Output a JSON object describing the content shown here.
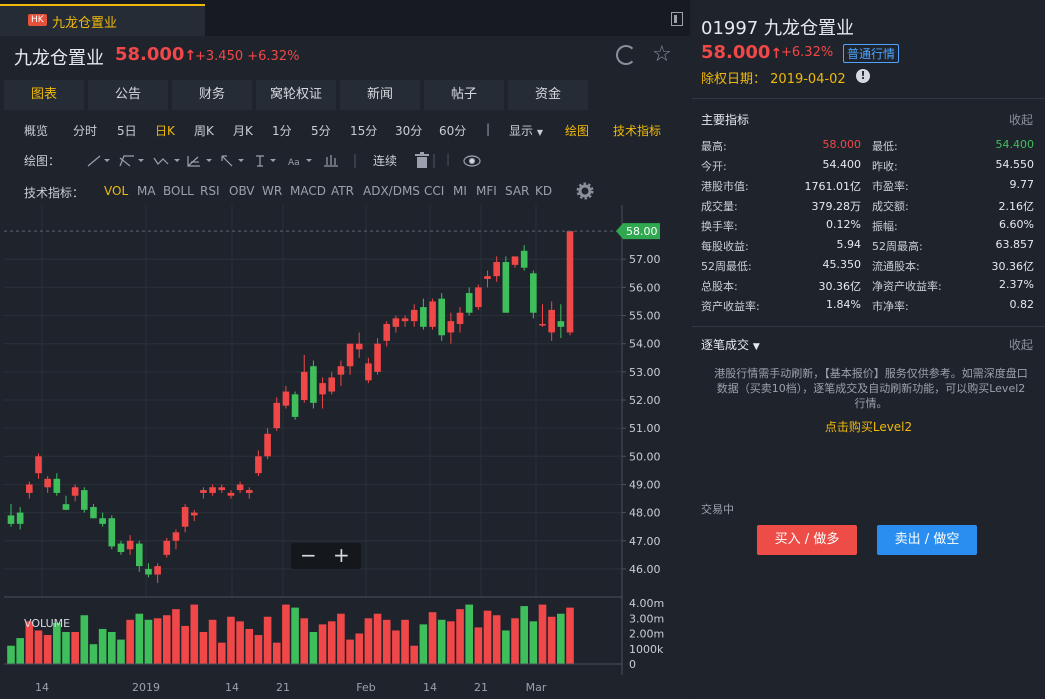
{
  "tab": {
    "market_badge": "HK",
    "title": "九龙仓置业"
  },
  "header": {
    "name": "九龙仓置业",
    "price": "58.000",
    "change": "+3.450",
    "change_pct": "+6.32%"
  },
  "nav_tabs": [
    "图表",
    "公告",
    "财务",
    "窝轮权证",
    "新闻",
    "帖子",
    "资金"
  ],
  "periods": [
    "概览",
    "分时",
    "5日",
    "日K",
    "周K",
    "月K",
    "1分",
    "5分",
    "15分",
    "30分",
    "60分"
  ],
  "period_active": "日K",
  "display_menu": "显示",
  "draw_link": "绘图",
  "tech_link": "技术指标",
  "draw_label": "绘图：",
  "continuous": "连续",
  "indicator_label": "技术指标：",
  "indicators": [
    "VOL",
    "MA",
    "BOLL",
    "RSI",
    "OBV",
    "WR",
    "MACD",
    "ATR",
    "ADX/DMS",
    "CCI",
    "MI",
    "MFI",
    "SAR",
    "KD"
  ],
  "indicator_active": "VOL",
  "chart_data": {
    "type": "candlestick",
    "last_price_label": "58.00",
    "y_ticks": [
      "57.00",
      "56.00",
      "55.00",
      "54.00",
      "53.00",
      "52.00",
      "51.00",
      "50.00",
      "49.00",
      "48.00",
      "47.00",
      "46.00"
    ],
    "ylim": [
      45.5,
      58.5
    ],
    "x_ticks": [
      "14",
      "2019",
      "14",
      "21",
      "Feb",
      "14",
      "21",
      "Mar"
    ],
    "volume_label": "VOLUME",
    "volume_ticks": [
      "4.00m",
      "3.00m",
      "2.00m",
      "1000k",
      "0"
    ],
    "volume_ylim": [
      0,
      4.2
    ],
    "up_color": "#f04848",
    "down_color": "#3fbf5c",
    "candles": [
      {
        "o": 47.9,
        "h": 48.3,
        "l": 47.5,
        "c": 47.6
      },
      {
        "o": 48.0,
        "h": 48.2,
        "l": 47.4,
        "c": 47.6
      },
      {
        "o": 48.7,
        "h": 49.1,
        "l": 48.5,
        "c": 49.0
      },
      {
        "o": 49.4,
        "h": 50.1,
        "l": 49.2,
        "c": 50.0
      },
      {
        "o": 48.9,
        "h": 49.3,
        "l": 48.7,
        "c": 49.2
      },
      {
        "o": 49.2,
        "h": 49.4,
        "l": 48.6,
        "c": 48.7
      },
      {
        "o": 48.3,
        "h": 48.6,
        "l": 48.1,
        "c": 48.1
      },
      {
        "o": 48.6,
        "h": 49.0,
        "l": 48.4,
        "c": 48.9
      },
      {
        "o": 48.8,
        "h": 48.9,
        "l": 48.0,
        "c": 48.1
      },
      {
        "o": 48.2,
        "h": 48.3,
        "l": 47.8,
        "c": 47.8
      },
      {
        "o": 47.8,
        "h": 48.0,
        "l": 47.5,
        "c": 47.6
      },
      {
        "o": 47.8,
        "h": 47.9,
        "l": 46.7,
        "c": 46.8
      },
      {
        "o": 46.9,
        "h": 47.0,
        "l": 46.5,
        "c": 46.6
      },
      {
        "o": 46.7,
        "h": 47.2,
        "l": 46.5,
        "c": 47.0
      },
      {
        "o": 46.9,
        "h": 47.0,
        "l": 45.9,
        "c": 46.1
      },
      {
        "o": 46.0,
        "h": 46.2,
        "l": 45.7,
        "c": 45.8
      },
      {
        "o": 45.8,
        "h": 46.2,
        "l": 45.5,
        "c": 46.1
      },
      {
        "o": 46.5,
        "h": 47.1,
        "l": 46.4,
        "c": 47.0
      },
      {
        "o": 47.0,
        "h": 47.4,
        "l": 46.7,
        "c": 47.3
      },
      {
        "o": 47.5,
        "h": 48.3,
        "l": 47.3,
        "c": 48.2
      },
      {
        "o": 47.9,
        "h": 48.1,
        "l": 47.7,
        "c": 48.0
      },
      {
        "o": 48.7,
        "h": 48.9,
        "l": 48.5,
        "c": 48.8
      },
      {
        "o": 48.7,
        "h": 49.0,
        "l": 48.6,
        "c": 48.9
      },
      {
        "o": 48.8,
        "h": 49.0,
        "l": 48.7,
        "c": 48.9
      },
      {
        "o": 48.6,
        "h": 48.8,
        "l": 48.5,
        "c": 48.7
      },
      {
        "o": 48.8,
        "h": 49.1,
        "l": 48.7,
        "c": 49.0
      },
      {
        "o": 48.7,
        "h": 48.9,
        "l": 48.5,
        "c": 48.8
      },
      {
        "o": 49.4,
        "h": 50.2,
        "l": 49.3,
        "c": 50.0
      },
      {
        "o": 50.0,
        "h": 51.0,
        "l": 49.9,
        "c": 50.8
      },
      {
        "o": 51.0,
        "h": 52.1,
        "l": 50.9,
        "c": 51.9
      },
      {
        "o": 51.8,
        "h": 52.5,
        "l": 51.7,
        "c": 52.3
      },
      {
        "o": 52.2,
        "h": 52.3,
        "l": 51.3,
        "c": 51.4
      },
      {
        "o": 52.0,
        "h": 53.6,
        "l": 51.9,
        "c": 53.0
      },
      {
        "o": 53.2,
        "h": 53.4,
        "l": 51.7,
        "c": 51.9
      },
      {
        "o": 52.2,
        "h": 52.8,
        "l": 51.7,
        "c": 52.6
      },
      {
        "o": 52.3,
        "h": 53.0,
        "l": 52.2,
        "c": 52.8
      },
      {
        "o": 52.9,
        "h": 53.4,
        "l": 52.5,
        "c": 53.2
      },
      {
        "o": 53.2,
        "h": 53.9,
        "l": 52.9,
        "c": 54.0
      },
      {
        "o": 53.8,
        "h": 54.4,
        "l": 53.5,
        "c": 54.0
      },
      {
        "o": 52.7,
        "h": 53.5,
        "l": 52.6,
        "c": 53.3
      },
      {
        "o": 53.0,
        "h": 54.2,
        "l": 52.9,
        "c": 54.0
      },
      {
        "o": 54.1,
        "h": 54.8,
        "l": 53.9,
        "c": 54.7
      },
      {
        "o": 54.6,
        "h": 55.0,
        "l": 54.4,
        "c": 54.9
      },
      {
        "o": 54.8,
        "h": 55.0,
        "l": 54.6,
        "c": 54.9
      },
      {
        "o": 54.8,
        "h": 55.4,
        "l": 54.6,
        "c": 55.2
      },
      {
        "o": 55.3,
        "h": 55.6,
        "l": 54.5,
        "c": 54.6
      },
      {
        "o": 54.6,
        "h": 55.6,
        "l": 54.5,
        "c": 55.5
      },
      {
        "o": 55.6,
        "h": 55.8,
        "l": 54.1,
        "c": 54.3
      },
      {
        "o": 54.4,
        "h": 55.1,
        "l": 54.0,
        "c": 54.8
      },
      {
        "o": 54.7,
        "h": 55.3,
        "l": 54.4,
        "c": 55.1
      },
      {
        "o": 55.8,
        "h": 56.0,
        "l": 55.0,
        "c": 55.1
      },
      {
        "o": 55.3,
        "h": 56.1,
        "l": 55.2,
        "c": 56.0
      },
      {
        "o": 56.3,
        "h": 56.6,
        "l": 56.0,
        "c": 56.4
      },
      {
        "o": 56.4,
        "h": 57.1,
        "l": 56.2,
        "c": 56.9
      },
      {
        "o": 56.9,
        "h": 57.1,
        "l": 55.1,
        "c": 55.1
      },
      {
        "o": 56.8,
        "h": 57.1,
        "l": 56.7,
        "c": 57.1
      },
      {
        "o": 57.3,
        "h": 57.5,
        "l": 56.6,
        "c": 56.7
      },
      {
        "o": 56.5,
        "h": 56.6,
        "l": 54.9,
        "c": 55.1
      },
      {
        "o": 54.7,
        "h": 55.4,
        "l": 54.6,
        "c": 54.7
      },
      {
        "o": 54.4,
        "h": 55.5,
        "l": 54.1,
        "c": 55.2
      },
      {
        "o": 54.8,
        "h": 55.4,
        "l": 54.2,
        "c": 54.6
      },
      {
        "o": 54.4,
        "h": 58.0,
        "l": 54.3,
        "c": 58.0
      }
    ],
    "volumes": [
      1.2,
      1.7,
      2.8,
      2.2,
      1.9,
      2.7,
      2.1,
      2.1,
      3.2,
      1.3,
      2.3,
      2.1,
      1.6,
      2.9,
      3.3,
      2.9,
      3.0,
      3.2,
      3.6,
      2.5,
      3.9,
      2.1,
      2.9,
      1.4,
      3.1,
      2.8,
      2.3,
      1.9,
      3.1,
      1.4,
      3.9,
      3.7,
      3.0,
      2.1,
      2.6,
      2.8,
      3.3,
      1.6,
      2.0,
      3.0,
      3.3,
      2.9,
      2.2,
      2.9,
      1.2,
      2.6,
      3.4,
      2.9,
      2.8,
      3.6,
      3.9,
      2.4,
      3.5,
      3.2,
      2.2,
      3.0,
      3.8,
      2.8,
      3.9,
      3.1,
      3.3,
      3.7
    ]
  },
  "right": {
    "title": "01997 九龙仓置业",
    "price": "58.000",
    "change_pct": "+6.32%",
    "quote_badge": "普通行情",
    "ex_date_label": "除权日期：",
    "ex_date": "2019-04-02",
    "info_icon": "!",
    "metrics_title": "主要指标",
    "collapse": "收起",
    "metrics": [
      {
        "k1": "最高:",
        "v1": "58.000",
        "c1": "#f04848",
        "k2": "最低:",
        "v2": "54.400",
        "c2": "#3fbf5c"
      },
      {
        "k1": "今开:",
        "v1": "54.400",
        "c1": "",
        "k2": "昨收:",
        "v2": "54.550",
        "c2": ""
      },
      {
        "k1": "港股市值:",
        "v1": "1761.01亿",
        "c1": "",
        "k2": "市盈率:",
        "v2": "9.77",
        "c2": ""
      },
      {
        "k1": "成交量:",
        "v1": "379.28万",
        "c1": "",
        "k2": "成交额:",
        "v2": "2.16亿",
        "c2": ""
      },
      {
        "k1": "换手率:",
        "v1": "0.12%",
        "c1": "",
        "k2": "振幅:",
        "v2": "6.60%",
        "c2": ""
      },
      {
        "k1": "每股收益:",
        "v1": "5.94",
        "c1": "",
        "k2": "52周最高:",
        "v2": "63.857",
        "c2": ""
      },
      {
        "k1": "52周最低:",
        "v1": "45.350",
        "c1": "",
        "k2": "流通股本:",
        "v2": "30.36亿",
        "c2": ""
      },
      {
        "k1": "总股本:",
        "v1": "30.36亿",
        "c1": "",
        "k2": "净资产收益率:",
        "v2": "2.37%",
        "c2": ""
      },
      {
        "k1": "资产收益率:",
        "v1": "1.84%",
        "c1": "",
        "k2": "市净率:",
        "v2": "0.82",
        "c2": ""
      }
    ],
    "tick_title": "逐笔成交",
    "tick_collapse": "收起",
    "tick_notice": "港股行情需手动刷新，【基本报价】服务仅供参考。如需深度盘口数据（买卖10档），逐笔成交及自动刷新功能，可以购买Level2行情。",
    "buy_level2": "点击购买Level2",
    "trading_status": "交易中",
    "buy_button": "买入 / 做多",
    "sell_button": "卖出 / 做空"
  }
}
